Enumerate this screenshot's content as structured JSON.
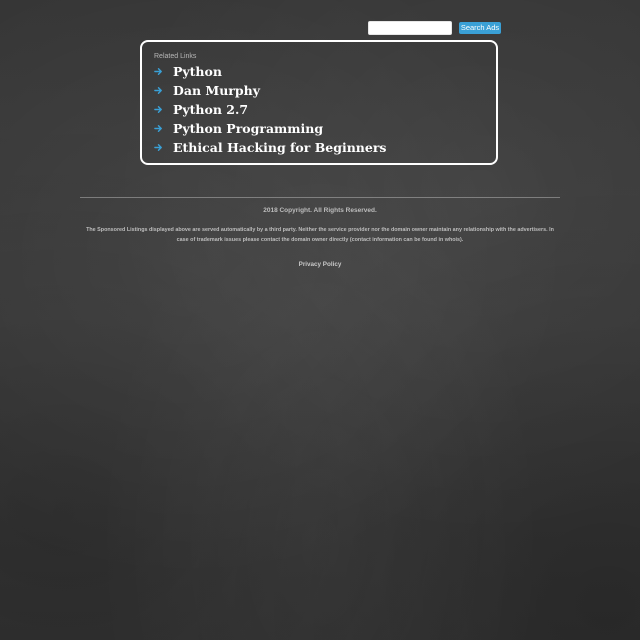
{
  "search": {
    "value": "",
    "button_label": "Search Ads"
  },
  "related_links": {
    "heading": "Related Links",
    "items": [
      {
        "label": "Python",
        "icon": "arrow-right-icon"
      },
      {
        "label": "Dan Murphy",
        "icon": "arrow-right-icon"
      },
      {
        "label": "Python 2.7",
        "icon": "arrow-right-icon"
      },
      {
        "label": "Python Programming",
        "icon": "arrow-right-icon"
      },
      {
        "label": "Ethical Hacking for Beginners",
        "icon": "arrow-right-icon"
      }
    ]
  },
  "footer": {
    "copyright": "2018 Copyright. All Rights Reserved.",
    "disclaimer": "The Sponsored Listings displayed above are served automatically by a third party. Neither the service provider nor the domain owner maintain any relationship with the advertisers. In case of trademark issues please contact the domain owner directly (contact information can be found in whois).",
    "privacy_label": "Privacy Policy"
  },
  "colors": {
    "background": "#3a3a3a",
    "accent": "#3aa0d6",
    "link_text": "#ffffff",
    "panel_border": "#ffffff"
  }
}
